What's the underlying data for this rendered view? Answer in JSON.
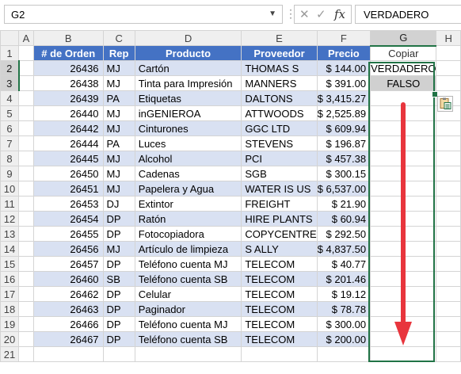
{
  "formula_bar": {
    "name_box": "G2",
    "cancel_icon": "x-icon",
    "enter_icon": "check-icon",
    "function_label": "fx",
    "formula": "VERDADERO"
  },
  "columns": [
    "A",
    "B",
    "C",
    "D",
    "E",
    "F",
    "G",
    "H"
  ],
  "selected_column": "G",
  "headers": {
    "orden": "# de Orden",
    "rep": "Rep",
    "producto": "Producto",
    "proveedor": "Proveedor",
    "precio": "Precio",
    "copiar": "Copiar"
  },
  "rows": [
    {
      "n": "1"
    },
    {
      "n": "2",
      "orden": "26436",
      "rep": "MJ",
      "producto": "Cartón",
      "proveedor": "THOMAS S",
      "precio": "$ 144.00",
      "copiar": "VERDADERO"
    },
    {
      "n": "3",
      "orden": "26438",
      "rep": "MJ",
      "producto": "Tinta para Impresión",
      "proveedor": "MANNERS",
      "precio": "$ 391.00",
      "copiar": "FALSO"
    },
    {
      "n": "4",
      "orden": "26439",
      "rep": "PA",
      "producto": "Etiquetas",
      "proveedor": "DALTONS",
      "precio": "$ 3,415.27"
    },
    {
      "n": "5",
      "orden": "26440",
      "rep": "MJ",
      "producto": "inGENIEROA",
      "proveedor": "ATTWOODS",
      "precio": "$ 2,525.89"
    },
    {
      "n": "6",
      "orden": "26442",
      "rep": "MJ",
      "producto": "Cinturones",
      "proveedor": "GGC LTD",
      "precio": "$ 609.94"
    },
    {
      "n": "7",
      "orden": "26444",
      "rep": "PA",
      "producto": "Luces",
      "proveedor": "STEVENS",
      "precio": "$ 196.87"
    },
    {
      "n": "8",
      "orden": "26445",
      "rep": "MJ",
      "producto": "Alcohol",
      "proveedor": "PCI",
      "precio": "$ 457.38"
    },
    {
      "n": "9",
      "orden": "26450",
      "rep": "MJ",
      "producto": "Cadenas",
      "proveedor": "SGB",
      "precio": "$ 300.15"
    },
    {
      "n": "10",
      "orden": "26451",
      "rep": "MJ",
      "producto": "Papelera y Agua",
      "proveedor": "WATER IS US",
      "precio": "$ 6,537.00"
    },
    {
      "n": "11",
      "orden": "26453",
      "rep": "DJ",
      "producto": "Extintor",
      "proveedor": "FREIGHT",
      "precio": "$ 21.90"
    },
    {
      "n": "12",
      "orden": "26454",
      "rep": "DP",
      "producto": "Ratón",
      "proveedor": "HIRE PLANTS",
      "precio": "$ 60.94"
    },
    {
      "n": "13",
      "orden": "26455",
      "rep": "DP",
      "producto": "Fotocopiadora",
      "proveedor": "COPYCENTRE",
      "precio": "$ 292.50"
    },
    {
      "n": "14",
      "orden": "26456",
      "rep": "MJ",
      "producto": "Artículo de limpieza",
      "proveedor": "S ALLY",
      "precio": "$ 4,837.50"
    },
    {
      "n": "15",
      "orden": "26457",
      "rep": "DP",
      "producto": "Teléfono cuenta MJ",
      "proveedor": "TELECOM",
      "precio": "$ 40.77"
    },
    {
      "n": "16",
      "orden": "26460",
      "rep": "SB",
      "producto": "Teléfono cuenta SB",
      "proveedor": "TELECOM",
      "precio": "$ 201.46"
    },
    {
      "n": "17",
      "orden": "26462",
      "rep": "DP",
      "producto": "Celular",
      "proveedor": "TELECOM",
      "precio": "$ 19.12"
    },
    {
      "n": "18",
      "orden": "26463",
      "rep": "DP",
      "producto": "Paginador",
      "proveedor": "TELECOM",
      "precio": "$ 78.78"
    },
    {
      "n": "19",
      "orden": "26466",
      "rep": "DP",
      "producto": "Teléfono cuenta MJ",
      "proveedor": "TELECOM",
      "precio": "$ 300.00"
    },
    {
      "n": "20",
      "orden": "26467",
      "rep": "DP",
      "producto": "Teléfono cuenta SB",
      "proveedor": "TELECOM",
      "precio": "$ 200.00"
    },
    {
      "n": "21"
    }
  ],
  "overlay": {
    "autofill_icon": "clipboard-paste-icon",
    "arrow_icon": "red-down-arrow-icon",
    "arrow_color": "#e8353d"
  },
  "colors": {
    "header_fill": "#4472c4",
    "band_fill": "#d9e1f2",
    "selection": "#217346"
  }
}
